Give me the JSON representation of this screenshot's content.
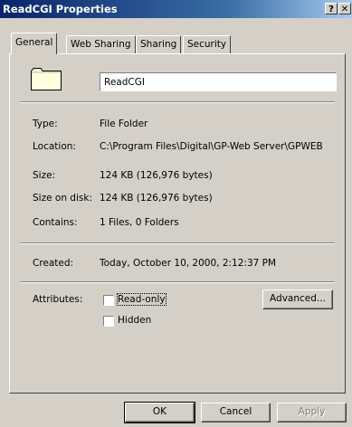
{
  "window": {
    "title": "ReadCGI Properties",
    "help_glyph": "?",
    "close_glyph": "✕"
  },
  "tabs": [
    {
      "label": "General",
      "active": true
    },
    {
      "label": "Web Sharing",
      "active": false
    },
    {
      "label": "Sharing",
      "active": false
    },
    {
      "label": "Security",
      "active": false
    }
  ],
  "general": {
    "name_value": "ReadCGI",
    "type_label": "Type:",
    "type_value": "File Folder",
    "location_label": "Location:",
    "location_value": "C:\\Program Files\\Digital\\GP-Web Server\\GPWEB",
    "size_label": "Size:",
    "size_value": "124 KB (126,976 bytes)",
    "size_on_disk_label": "Size on disk:",
    "size_on_disk_value": "124 KB (126,976 bytes)",
    "contains_label": "Contains:",
    "contains_value": "1 Files, 0 Folders",
    "created_label": "Created:",
    "created_value": "Today, October 10, 2000, 2:12:37 PM",
    "attributes_label": "Attributes:",
    "readonly_label": "Read-only",
    "hidden_label": "Hidden",
    "advanced_label": "Advanced..."
  },
  "buttons": {
    "ok": "OK",
    "cancel": "Cancel",
    "apply": "Apply"
  },
  "icons": {
    "folder": "folder-icon"
  },
  "colors": {
    "titlebar_start": "#0a246a",
    "titlebar_end": "#a6caf0",
    "face": "#d4d0c8",
    "folder": "#ffffe0"
  }
}
